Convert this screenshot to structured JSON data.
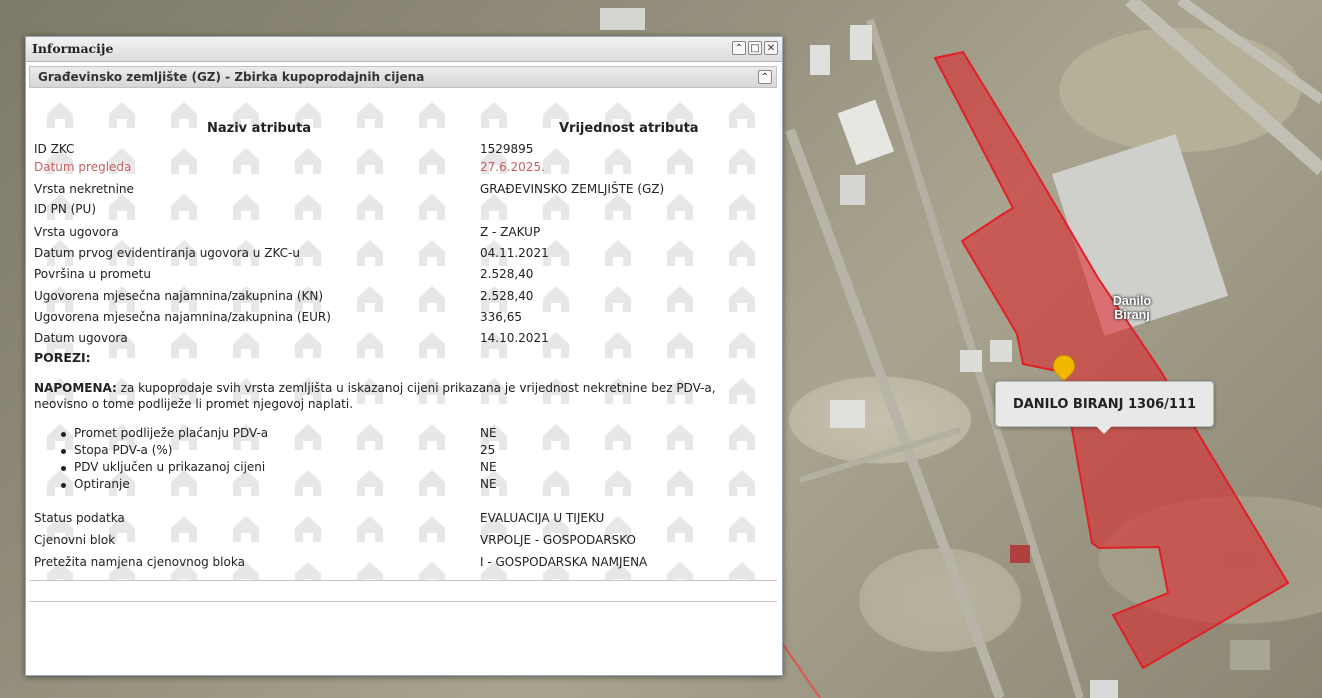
{
  "map": {
    "place_label_lines": [
      "Danilo",
      "Biranj"
    ],
    "tooltip": "DANILO BIRANJ 1306/111",
    "parcel_color": "#e21f26"
  },
  "panel": {
    "title": "Informacije",
    "section_title": "Građevinsko zemljište (GZ) - Zbirka kupoprodajnih cijena",
    "col_name": "Naziv atributa",
    "col_value": "Vrijednost atributa",
    "attributes": [
      {
        "name": "ID ZKC",
        "value": "1529895"
      },
      {
        "name": "Datum pregleda",
        "value": "27.6.2025."
      },
      {
        "name": "Vrsta nekretnine",
        "value": "GRAĐEVINSKO ZEMLJIŠTE (GZ)"
      },
      {
        "name": "ID PN (PU)",
        "value": ""
      },
      {
        "name": "Vrsta ugovora",
        "value": "Z - ZAKUP"
      },
      {
        "name": "Datum prvog evidentiranja ugovora u ZKC-u",
        "value": "04.11.2021"
      },
      {
        "name": "Površina u prometu",
        "value": "2.528,40"
      },
      {
        "name": "Ugovorena mjesečna najamnina/zakupnina (KN)",
        "value": "2.528,40"
      },
      {
        "name": "Ugovorena mjesečna najamnina/zakupnina (EUR)",
        "value": "336,65"
      },
      {
        "name": "Datum ugovora",
        "value": "14.10.2021"
      }
    ],
    "porezi_label": "POREZI:",
    "napomena_label": "NAPOMENA:",
    "napomena_text": "za kupoprodaje svih vrsta zemljišta u iskazanoj cijeni prikazana je vrijednost nekretnine bez PDV-a, neovisno o tome podliježe li promet njegovoj naplati.",
    "tax_items": [
      {
        "name": "Promet podliježe plaćanju PDV-a",
        "value": "NE"
      },
      {
        "name": "Stopa PDV-a (%)",
        "value": "25"
      },
      {
        "name": "PDV uključen u prikazanoj cijeni",
        "value": "NE"
      },
      {
        "name": "Optiranje",
        "value": "NE"
      }
    ],
    "status_rows": [
      {
        "name": "Status podatka",
        "value": "EVALUACIJA U TIJEKU"
      },
      {
        "name": "Cjenovni blok",
        "value": "VRPOLJE - GOSPODARSKO"
      },
      {
        "name": "Pretežita namjena cjenovnog bloka",
        "value": "I - GOSPODARSKA NAMJENA"
      }
    ],
    "highlight_color": "#c76060"
  }
}
